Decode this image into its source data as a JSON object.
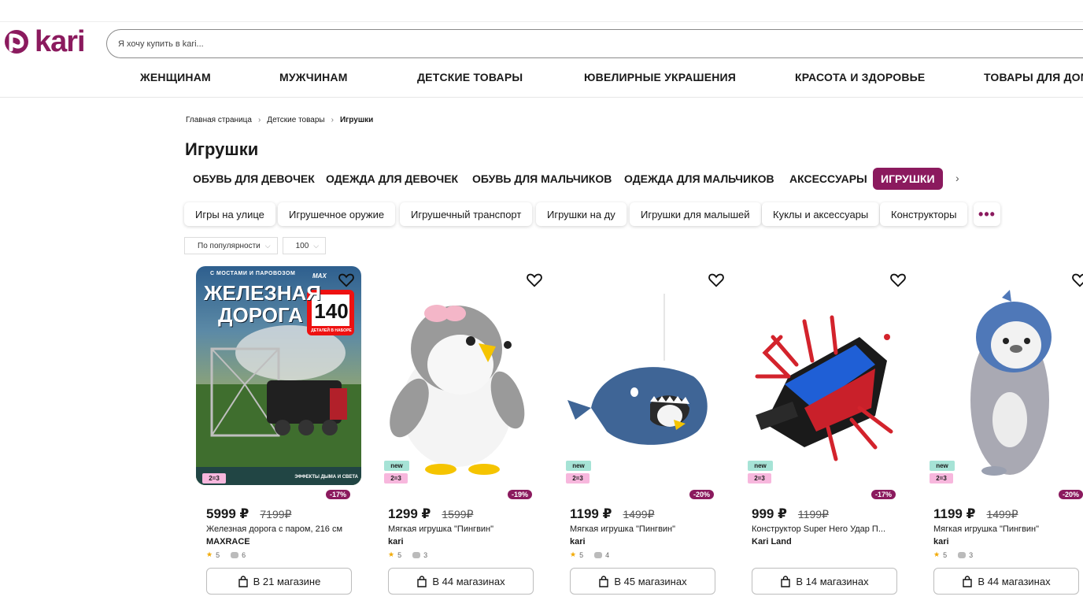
{
  "header": {
    "logo_text": "kari",
    "search_placeholder": "Я хочу купить в kari..."
  },
  "main_nav": [
    "ЖЕНЩИНАМ",
    "МУЖЧИНАМ",
    "ДЕТСКИЕ ТОВАРЫ",
    "ЮВЕЛИРНЫЕ УКРАШЕНИЯ",
    "КРАСОТА И ЗДОРОВЬЕ",
    "ТОВАРЫ ДЛЯ ДОМА"
  ],
  "breadcrumbs": [
    "Главная страница",
    "Детские товары",
    "Игрушки"
  ],
  "page_title": "Игрушки",
  "categories": [
    {
      "label": "ОБУВЬ ДЛЯ ДЕВОЧЕК",
      "active": false
    },
    {
      "label": "ОДЕЖДА ДЛЯ ДЕВОЧЕК",
      "active": false
    },
    {
      "label": "ОБУВЬ ДЛЯ МАЛЬЧИКОВ",
      "active": false
    },
    {
      "label": "ОДЕЖДА ДЛЯ МАЛЬЧИКОВ",
      "active": false
    },
    {
      "label": "АКСЕССУАРЫ",
      "active": false
    },
    {
      "label": "ИГРУШКИ",
      "active": true
    }
  ],
  "chips": [
    "Игры на улице",
    "Игрушечное оружие",
    "Игрушечный транспорт",
    "Игрушки на ду",
    "Игрушки для малышей",
    "Куклы и аксессуары",
    "Конструкторы"
  ],
  "chip_more": "•••",
  "sort": {
    "label": "По популярности",
    "per_page": "100"
  },
  "products": [
    {
      "image_badge_top": "С МОСТАМИ И ПАРОВОЗОМ",
      "image_title_1": "ЖЕЛЕЗНАЯ",
      "image_title_2": "ДОРОГА",
      "image_count": "140",
      "image_count_caption": "ДЕТАЛЕЙ В НАБОРЕ",
      "image_footer": "ЭФФЕКТЫ ДЫМА И СВЕТА",
      "image_brand": "MAX",
      "new": false,
      "promo": "2=3",
      "discount": "-17%",
      "price": "5999 ₽",
      "old_price": "7199₽",
      "name": "Железная дорога с паром, 216 см",
      "brand": "MAXRACE",
      "rating": "5",
      "reviews": "6",
      "stores": "В 21 магазине"
    },
    {
      "new": true,
      "new_label": "new",
      "promo": "2=3",
      "discount": "-19%",
      "price": "1299 ₽",
      "old_price": "1599₽",
      "name": "Мягкая игрушка \"Пингвин\"",
      "brand": "kari",
      "rating": "5",
      "reviews": "3",
      "stores": "В 44 магазинах"
    },
    {
      "new": true,
      "new_label": "new",
      "promo": "2=3",
      "discount": "-20%",
      "price": "1199 ₽",
      "old_price": "1499₽",
      "name": "Мягкая игрушка \"Пингвин\"",
      "brand": "kari",
      "rating": "5",
      "reviews": "4",
      "stores": "В 45 магазинах"
    },
    {
      "new": true,
      "new_label": "new",
      "promo": "2=3",
      "discount": "-17%",
      "price": "999 ₽",
      "old_price": "1199₽",
      "name": "Конструктор Super Hero Удар П...",
      "brand": "Kari Land",
      "rating": "",
      "reviews": "",
      "stores": "В 14 магазинах"
    },
    {
      "new": true,
      "new_label": "new",
      "promo": "2=3",
      "discount": "-20%",
      "price": "1199 ₽",
      "old_price": "1499₽",
      "name": "Мягкая игрушка \"Пингвин\"",
      "brand": "kari",
      "rating": "5",
      "reviews": "3",
      "stores": "В 44 магазинах"
    }
  ],
  "colors": {
    "brand": "#8b1a5e",
    "new_badge": "#a6e3d6",
    "promo_badge": "#f7b7dd",
    "star": "#f2a900"
  }
}
